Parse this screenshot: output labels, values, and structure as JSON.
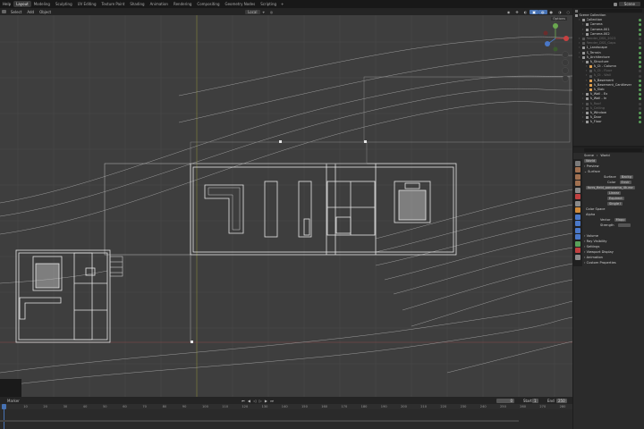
{
  "topbar": {
    "menus": [
      "Help"
    ],
    "workspaces": [
      "Layout",
      "Modeling",
      "Sculpting",
      "UV Editing",
      "Texture Paint",
      "Shading",
      "Animation",
      "Rendering",
      "Compositing",
      "Geometry Nodes",
      "Scripting"
    ],
    "active_workspace": "Layout",
    "scene_label": "Scene"
  },
  "viewport_header": {
    "items": [
      "Select",
      "Add",
      "Object"
    ],
    "transform_orientation": "Local",
    "options_label": "Options"
  },
  "outliner": {
    "title": "Scene Collection",
    "rows": [
      {
        "label": "Collection",
        "dim": false,
        "indent": 1,
        "color": "#cfcfcf"
      },
      {
        "label": "Camera",
        "dim": false,
        "indent": 2,
        "color": "#cfcfcf"
      },
      {
        "label": "Camera.001",
        "dim": false,
        "indent": 2,
        "color": "#cfcfcf"
      },
      {
        "label": "Camera.002",
        "dim": false,
        "indent": 2,
        "color": "#cfcfcf"
      },
      {
        "label": "Render_DSS_2023",
        "dim": true,
        "indent": 1,
        "color": "#6d6d6d"
      },
      {
        "label": "Render_DSS_Gaps",
        "dim": true,
        "indent": 1,
        "color": "#6d6d6d"
      },
      {
        "label": "1_Landscape",
        "dim": false,
        "indent": 1,
        "color": "#cfcfcf"
      },
      {
        "label": "S_Terrain",
        "dim": false,
        "indent": 1,
        "color": "#cfcfcf"
      },
      {
        "label": "A_Architecture",
        "dim": false,
        "indent": 1,
        "color": "#cfcfcf"
      },
      {
        "label": "A_Structure",
        "dim": false,
        "indent": 2,
        "color": "#cfcfcf"
      },
      {
        "label": "A_Ct - Column",
        "dim": false,
        "indent": 3,
        "color": "#cfcfcf"
      },
      {
        "label": "A_Ct - Floor",
        "dim": true,
        "indent": 3,
        "color": "#6d6d6d"
      },
      {
        "label": "A_Ct - Wall",
        "dim": true,
        "indent": 3,
        "color": "#6d6d6d"
      },
      {
        "label": "A_Basement",
        "dim": false,
        "indent": 3,
        "color": "#cfcfcf"
      },
      {
        "label": "A_Basement_Cantilever",
        "dim": false,
        "indent": 3,
        "color": "#cfcfcf"
      },
      {
        "label": "A_Slab",
        "dim": false,
        "indent": 3,
        "color": "#cfcfcf"
      },
      {
        "label": "A_Wall - Ex",
        "dim": false,
        "indent": 2,
        "color": "#cfcfcf"
      },
      {
        "label": "A_Wall - In",
        "dim": false,
        "indent": 2,
        "color": "#cfcfcf"
      },
      {
        "label": "A_Roof",
        "dim": true,
        "indent": 2,
        "color": "#6d6d6d"
      },
      {
        "label": "A_Ceiling",
        "dim": true,
        "indent": 2,
        "color": "#6d6d6d"
      },
      {
        "label": "A_Window",
        "dim": false,
        "indent": 2,
        "color": "#cfcfcf"
      },
      {
        "label": "A_Door",
        "dim": false,
        "indent": 2,
        "color": "#cfcfcf"
      },
      {
        "label": "A_Floor",
        "dim": false,
        "indent": 2,
        "color": "#cfcfcf"
      }
    ]
  },
  "properties": {
    "breadcrumb_scene": "Scene",
    "breadcrumb_world": "World",
    "datablock": "World",
    "panels": {
      "preview": "Preview",
      "surface": "Surface",
      "surface_label": "Surface",
      "surface_value": "Backg",
      "color_label": "Color",
      "color_value": "Envir",
      "image_name": "forrs_field_panorama_4k.exr",
      "interp": "Linear",
      "proj": "Equirect",
      "ext": "Single I",
      "color_space": "Color Space",
      "alpha": "Alpha",
      "vector_label": "Vector",
      "vector_value": "Mapp",
      "strength_label": "Strength",
      "volume": "Volume",
      "ray_visibility": "Ray Visibility",
      "settings": "Settings",
      "viewport_display": "Viewport Display",
      "animation": "Animation",
      "custom_properties": "Custom Properties"
    }
  },
  "timeline": {
    "menu": "Marker",
    "current_frame": "0",
    "start_label": "Start",
    "start_value": "1",
    "end_label": "End",
    "end_value": "250",
    "ruler": [
      "0",
      "10",
      "20",
      "30",
      "40",
      "50",
      "60",
      "70",
      "80",
      "90",
      "100",
      "110",
      "120",
      "130",
      "140",
      "150",
      "160",
      "170",
      "180",
      "190",
      "200",
      "210",
      "220",
      "230",
      "240",
      "250",
      "260",
      "270",
      "280"
    ]
  },
  "colors": {
    "accent": "#4772b3",
    "viewport_bg": "#3e3e3e",
    "wire": "#e6e6e6"
  }
}
